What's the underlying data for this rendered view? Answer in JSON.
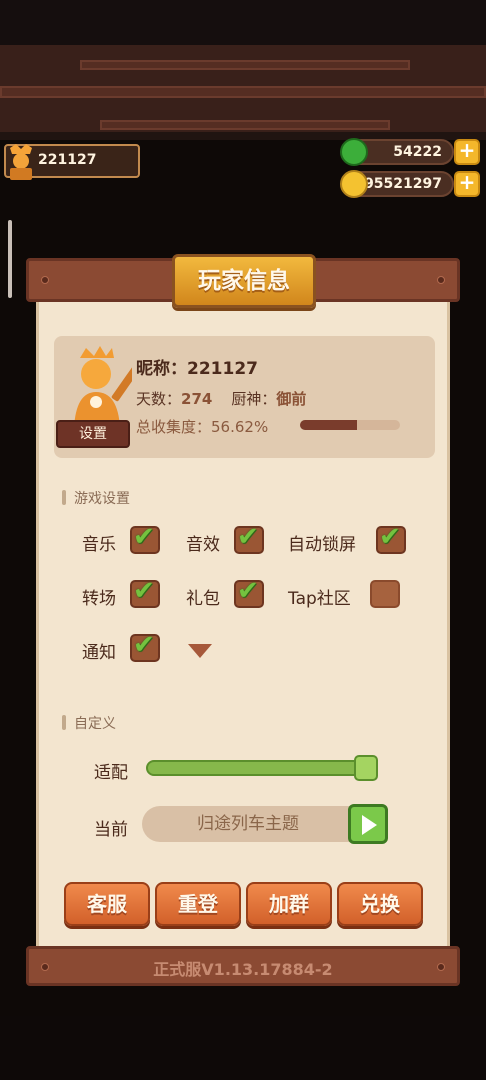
{
  "player": {
    "id": "221127"
  },
  "resources": {
    "gems": "54222",
    "coins": "95521297"
  },
  "panel": {
    "title": "玩家信息",
    "profile": {
      "name_label": "昵称：",
      "name_value": "221127",
      "days_label": "天数：",
      "days_value": "274",
      "chef_label": "厨神：",
      "chef_value": "御前",
      "collect_label": "总收集度：",
      "collect_value": "56.62%",
      "collect_fraction": 0.5662,
      "settings_button": "设置"
    },
    "game_settings": {
      "label": "游戏设置",
      "options": [
        {
          "label": "音乐",
          "checked": true
        },
        {
          "label": "音效",
          "checked": true
        },
        {
          "label": "自动锁屏",
          "checked": true
        },
        {
          "label": "转场",
          "checked": true
        },
        {
          "label": "礼包",
          "checked": true
        },
        {
          "label": "Tap社区",
          "checked": false
        },
        {
          "label": "通知",
          "checked": true
        }
      ]
    },
    "custom": {
      "label": "自定义",
      "adapt_label": "适配",
      "adapt_level": 1.0,
      "current_label": "当前",
      "theme_value": "归途列车主题"
    },
    "actions": [
      "客服",
      "重登",
      "加群",
      "兑换"
    ],
    "version": "正式服V1.13.17884-2"
  },
  "colors": {
    "accent_green": "#74c23f",
    "panel_paper": "#f3e5cf",
    "title_gold": "#e6a52c",
    "action_orange": "#e2743a"
  }
}
